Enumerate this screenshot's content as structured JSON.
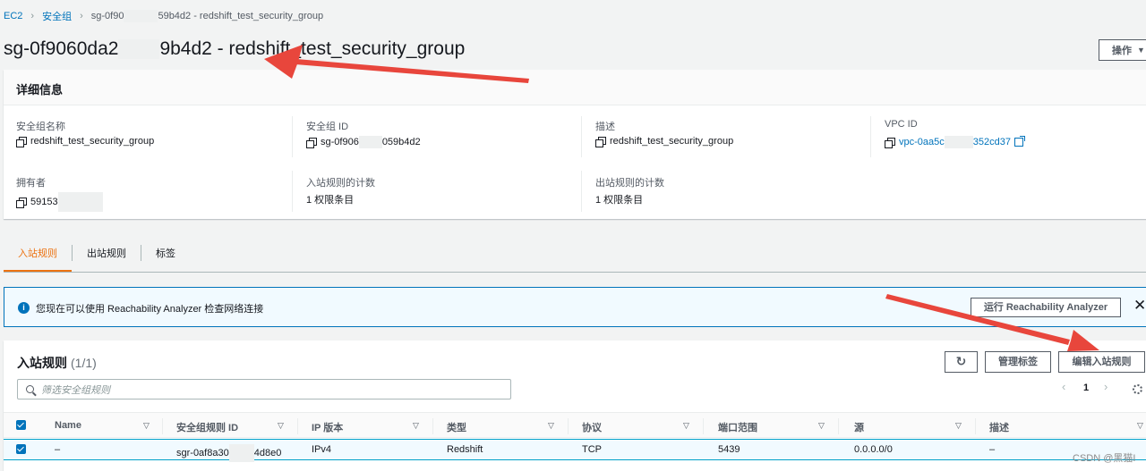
{
  "breadcrumb": {
    "root": "EC2",
    "section": "安全组",
    "current_prefix": "sg-0f90",
    "current_suffix": "59b4d2 - redshift_test_security_group"
  },
  "header": {
    "title_prefix": "sg-0f9060da2",
    "title_suffix": "9b4d2 - redshift_test_security_group",
    "actions_label": "操作"
  },
  "details": {
    "heading": "详细信息",
    "fields": [
      {
        "label": "安全组名称",
        "value": "redshift_test_security_group"
      },
      {
        "label": "安全组 ID",
        "value_prefix": "sg-0f906",
        "value_suffix": "059b4d2"
      },
      {
        "label": "描述",
        "value": "redshift_test_security_group"
      },
      {
        "label": "VPC ID",
        "value_prefix": "vpc-0aa5c",
        "value_suffix": "352cd37"
      },
      {
        "label": "拥有者",
        "value": "59153"
      },
      {
        "label": "入站规则的计数",
        "value": "1 权限条目"
      },
      {
        "label": "出站规则的计数",
        "value": "1 权限条目"
      }
    ]
  },
  "tabs": [
    {
      "label": "入站规则",
      "active": true
    },
    {
      "label": "出站规则",
      "active": false
    },
    {
      "label": "标签",
      "active": false
    }
  ],
  "flash": {
    "message": "您现在可以使用 Reachability Analyzer 检查网络连接",
    "button": "运行 Reachability Analyzer",
    "close": "✕"
  },
  "rules": {
    "title": "入站规则",
    "count": "(1/1)",
    "refresh_icon": "refresh-icon",
    "manage_tags": "管理标签",
    "edit_rules": "编辑入站规则",
    "search_placeholder": "筛选安全组规则",
    "page": "1",
    "columns": [
      "Name",
      "安全组规则 ID",
      "IP 版本",
      "类型",
      "协议",
      "端口范围",
      "源",
      "描述"
    ],
    "rows": [
      {
        "name": "–",
        "rule_id_prefix": "sgr-0af8a30",
        "rule_id_suffix": "4d8e0",
        "ip_version": "IPv4",
        "type": "Redshift",
        "protocol": "TCP",
        "port_range": "5439",
        "source": "0.0.0.0/0",
        "description": "–"
      }
    ]
  },
  "watermark": "CSDN @黑猫I",
  "colors": {
    "accent": "#ec7211",
    "link": "#0073bb",
    "annotation_arrow": "#e8463c"
  }
}
